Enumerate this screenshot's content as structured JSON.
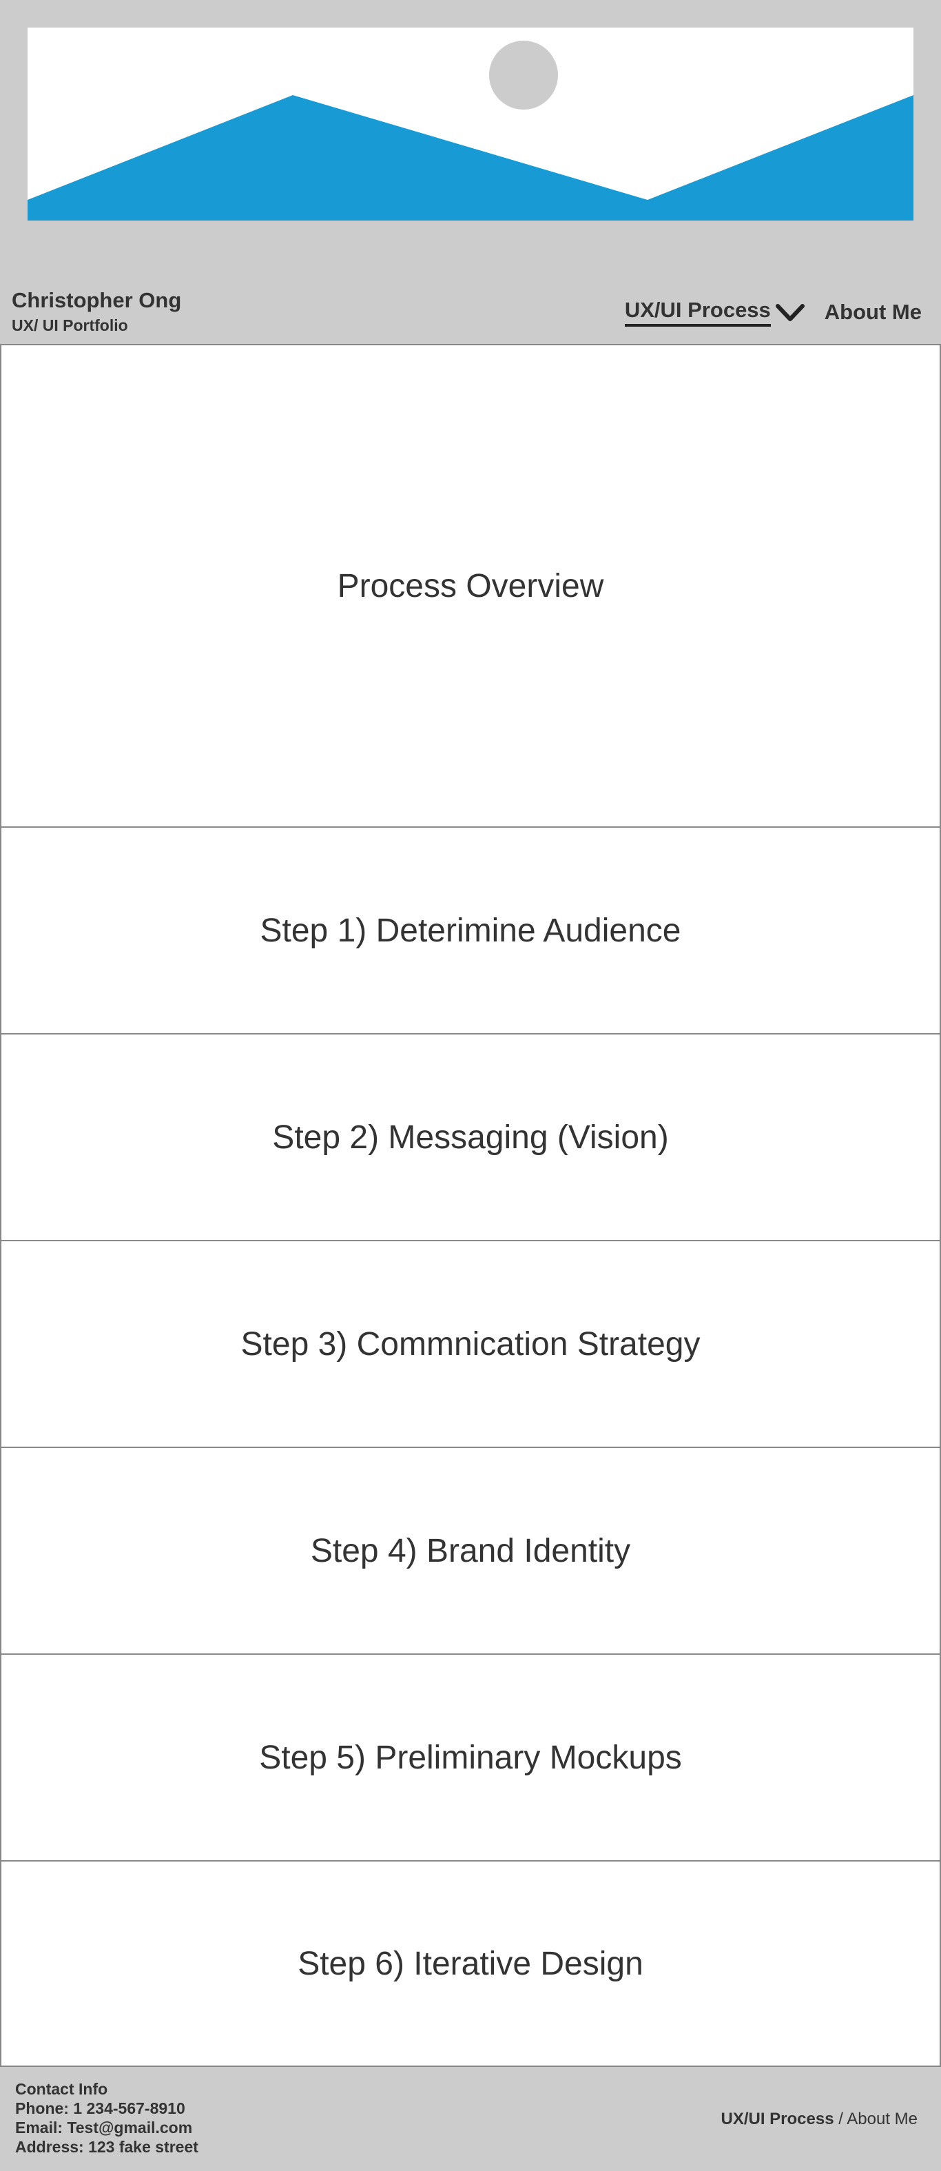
{
  "header": {
    "name": "Christopher Ong",
    "subtitle": "UX/ UI Portfolio"
  },
  "nav": {
    "process_label": "UX/UI Process",
    "about_label": "About Me"
  },
  "colors": {
    "background": "#cccccc",
    "accent": "#189bd5",
    "placeholder_circle": "#cccccc"
  },
  "sections": {
    "overview": "Process Overview",
    "steps": [
      "Step 1) Deterimine Audience",
      "Step 2) Messaging (Vision)",
      "Step 3) Commnication Strategy",
      "Step 4) Brand Identity",
      "Step 5) Preliminary Mockups",
      "Step 6) Iterative Design"
    ]
  },
  "footer": {
    "contact_title": "Contact Info",
    "phone": "Phone: 1 234-567-8910",
    "email": "Email: Test@gmail.com",
    "address": "Address: 123 fake street",
    "nav_process": "UX/UI Process",
    "nav_separator": " / ",
    "nav_about": "About Me"
  }
}
